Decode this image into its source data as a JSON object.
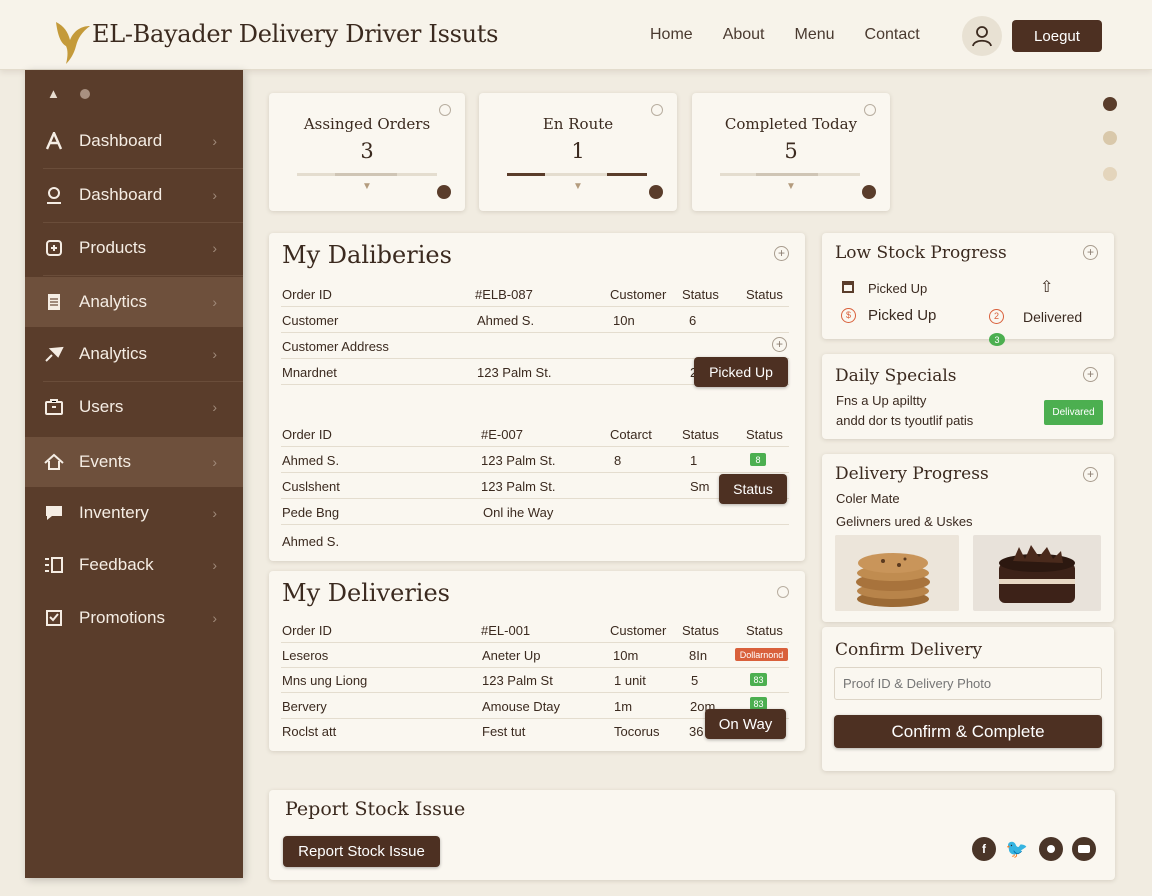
{
  "header": {
    "title": "EL-Bayader Delivery Driver Issuts",
    "nav": [
      "Home",
      "About",
      "Menu",
      "Contact"
    ],
    "logout": "Loegut"
  },
  "sidebar": {
    "items": [
      {
        "label": "Dashboard",
        "icon": "letter-a-icon"
      },
      {
        "label": "Dashboard",
        "icon": "user-circle-icon"
      },
      {
        "label": "Products",
        "icon": "box-icon"
      },
      {
        "label": "Analytics",
        "icon": "document-icon"
      },
      {
        "label": "Analytics",
        "icon": "pin-icon"
      },
      {
        "label": "Users",
        "icon": "briefcase-icon"
      },
      {
        "label": "Events",
        "icon": "house-icon"
      },
      {
        "label": "Inventery",
        "icon": "chat-icon"
      },
      {
        "label": "Feedback",
        "icon": "list-icon"
      },
      {
        "label": "Promotions",
        "icon": "checkbox-icon"
      }
    ],
    "active_index": [
      3,
      6
    ]
  },
  "stats": [
    {
      "title": "Assinged Orders",
      "value": "3"
    },
    {
      "title": "En Route",
      "value": "1"
    },
    {
      "title": "Completed Today",
      "value": "5"
    }
  ],
  "dalib": {
    "title": "My Daliberies",
    "rows1": [
      [
        "Order ID",
        "#ELB-087",
        "Customer",
        "Status",
        "Status"
      ],
      [
        "Customer",
        "Ahmed S.",
        "10n",
        "6",
        ""
      ],
      [
        "Customer Address",
        "",
        "",
        "",
        ""
      ],
      [
        "Mnardnet",
        "123 Palm St.",
        "",
        "2",
        ""
      ]
    ],
    "picked_btn": "Picked Up",
    "rows2": [
      [
        "Order ID",
        "#E-007",
        "Cotarct",
        "Status",
        "Status"
      ],
      [
        "Ahmed S.",
        "123 Palm St.",
        "8",
        "1",
        ""
      ],
      [
        "Cuslshent",
        "123 Palm St.",
        "",
        "Sm",
        ""
      ],
      [
        "Pede Bng",
        "Onl ihe Way",
        "",
        "",
        ""
      ],
      [
        "Ahmed S.",
        "",
        "",
        "",
        ""
      ]
    ],
    "badge": "8",
    "status_btn": "Status"
  },
  "deliv": {
    "title": "My Deliveries",
    "rows": [
      [
        "Order ID",
        "#EL-001",
        "Customer",
        "Status",
        "Status"
      ],
      [
        "Leseros",
        "Aneter Up",
        "10m",
        "8In",
        ""
      ],
      [
        "Mns ung Liong",
        "123 Palm St",
        "1 unit",
        "5",
        ""
      ],
      [
        "Bervery",
        "Amouse Dtay",
        "1m",
        "2om",
        ""
      ],
      [
        "Roclst att",
        "Fest tut",
        "Tocorus",
        "36",
        ""
      ]
    ],
    "red_badge": "Dollarnond",
    "green_badge1": "83",
    "green_badge2": "83",
    "onway_btn": "On Way"
  },
  "low_stock": {
    "title": "Low Stock Progress",
    "item1": "Picked Up",
    "item2": "Picked Up",
    "item3": "Delivered",
    "badge": "3"
  },
  "daily": {
    "title": "Daily Specials",
    "line1": "Fns a Up apiltty",
    "line2": "andd dor ts tyoutlif patis",
    "badge": "Delivared"
  },
  "progress": {
    "title": "Delivery Progress",
    "line1": "Coler Mate",
    "line2": "Gelivners ured & Uskes"
  },
  "confirm": {
    "title": "Confirm Delivery",
    "placeholder": "Proof ID & Delivery Photo",
    "button": "Confirm & Complete"
  },
  "report": {
    "title": "Peport Stock Issue",
    "button": "Report Stock Issue"
  },
  "social": [
    "facebook-icon",
    "twitter-icon",
    "circle-icon",
    "camera-icon"
  ],
  "colors": {
    "brand": "#5a3d2b",
    "button": "#4d3022",
    "bg": "#f1ece1",
    "green": "#4caf50",
    "red": "#d9603b"
  }
}
